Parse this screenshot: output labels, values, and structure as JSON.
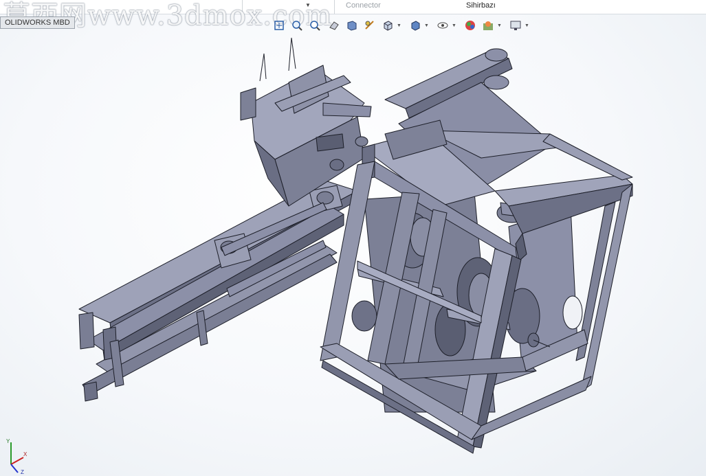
{
  "topbar": {
    "connector_label": "Connector",
    "sihirbazi_label": "Sihirbazı"
  },
  "watermark": {
    "text": "莫西网www.3dmox.com"
  },
  "doc_tab": {
    "label": "OLIDWORKS MBD"
  },
  "view_toolbar": {
    "icons": [
      "zoom-to-fit-icon",
      "zoom-area-icon",
      "zoom-in-icon",
      "previous-view-icon",
      "section-view-icon",
      "dynamic-annotation-icon",
      "view-orientation-icon",
      "display-style-icon",
      "hide-show-icon",
      "edit-appearance-icon",
      "apply-scene-icon",
      "view-settings-icon"
    ]
  },
  "colors": {
    "model_face": "#8c90a8",
    "model_dark": "#5a5e72",
    "model_edge": "#1c1e28",
    "background": "#f4f7fa"
  },
  "triad": {
    "y_label": "Y",
    "x_label": "X",
    "z_label": "Z"
  }
}
